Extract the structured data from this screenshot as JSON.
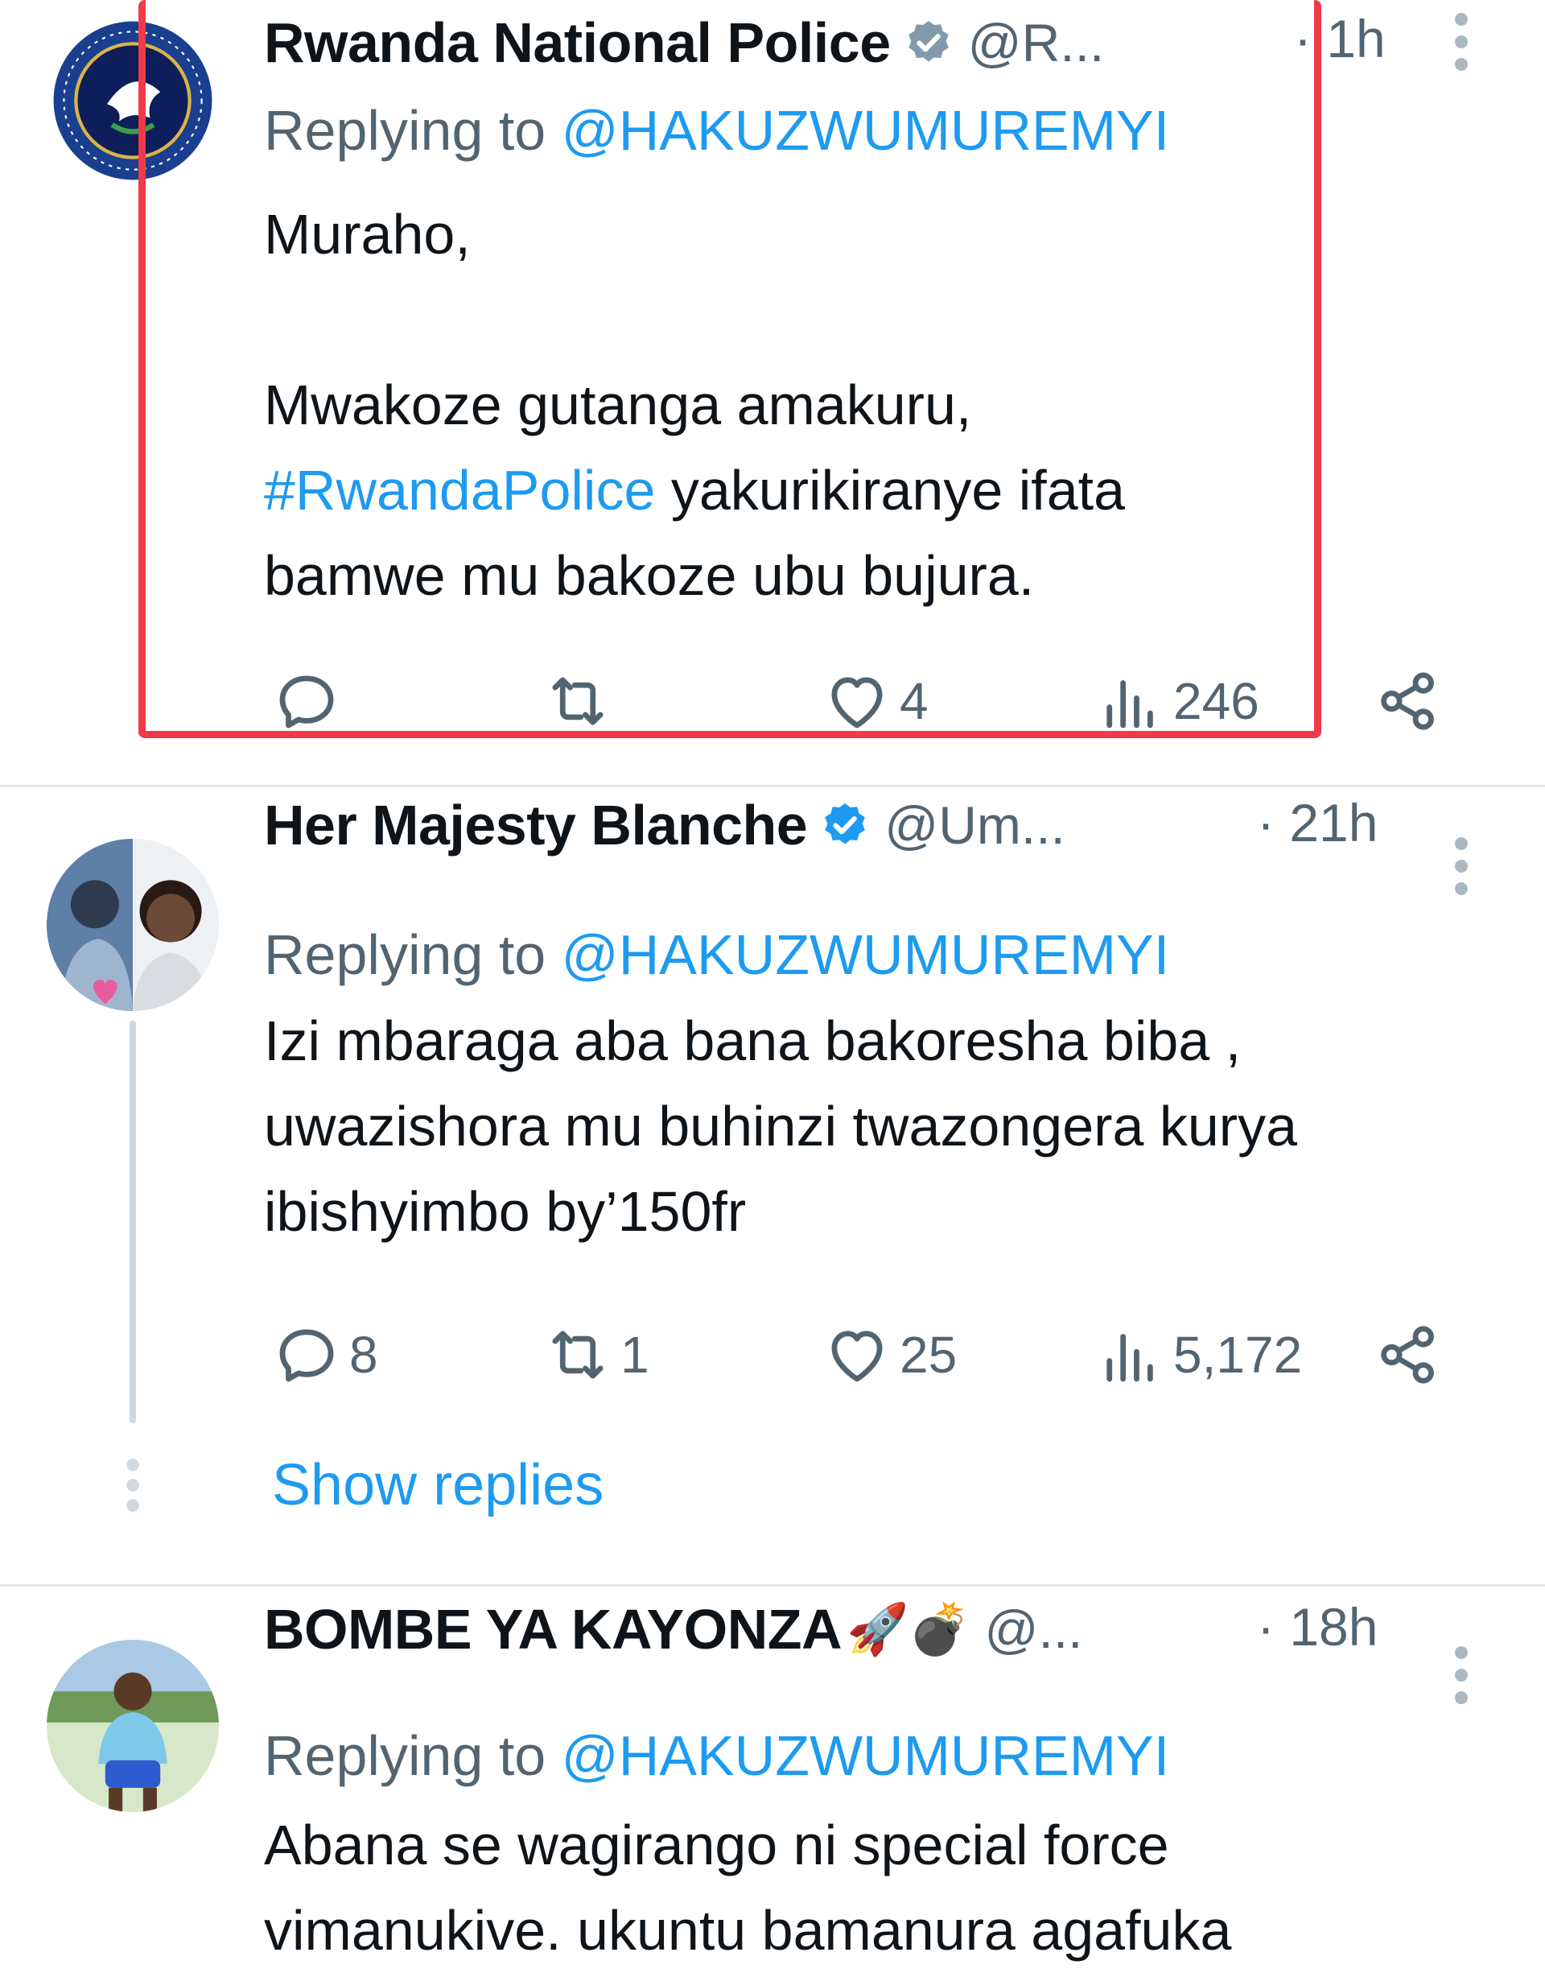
{
  "tweets": [
    {
      "name": "Rwanda National Police",
      "handle": "@R...",
      "time": "· 1h",
      "replying_prefix": "Replying to",
      "replying_to": "@HAKUZWUMUREMYI",
      "greeting": "Muraho,",
      "text_line1": "Mwakoze gutanga amakuru,",
      "hashtag": "#RwandaPolice",
      "text_line2_rest": " yakurikiranye ifata",
      "text_line3": "bamwe mu bakoze ubu bujura.",
      "stats": {
        "replies": "",
        "retweets": "",
        "likes": "4",
        "views": "246"
      }
    },
    {
      "name": "Her Majesty Blanche",
      "handle": "@Um...",
      "time": "· 21h",
      "replying_prefix": "Replying to",
      "replying_to": "@HAKUZWUMUREMYI",
      "text_line1": "Izi mbaraga aba bana bakoresha biba ,",
      "text_line2": "uwazishora mu buhinzi twazongera kurya",
      "text_line3": "ibishyimbo by’150fr",
      "stats": {
        "replies": "8",
        "retweets": "1",
        "likes": "25",
        "views": "5,172"
      },
      "show_replies": "Show replies"
    },
    {
      "name": "BOMBE YA KAYONZA",
      "name_emoji": "🚀💣",
      "handle": "@...",
      "time": "· 18h",
      "replying_prefix": "Replying to",
      "replying_to": "@HAKUZWUMUREMYI",
      "text_line1": "Abana se wagirango ni special force",
      "text_line2": "vimanukive. ukuntu bamanura agafuka"
    }
  ],
  "colors": {
    "accent": "#1d9bf0",
    "muted": "#536471",
    "highlight_border": "#f03a47"
  }
}
